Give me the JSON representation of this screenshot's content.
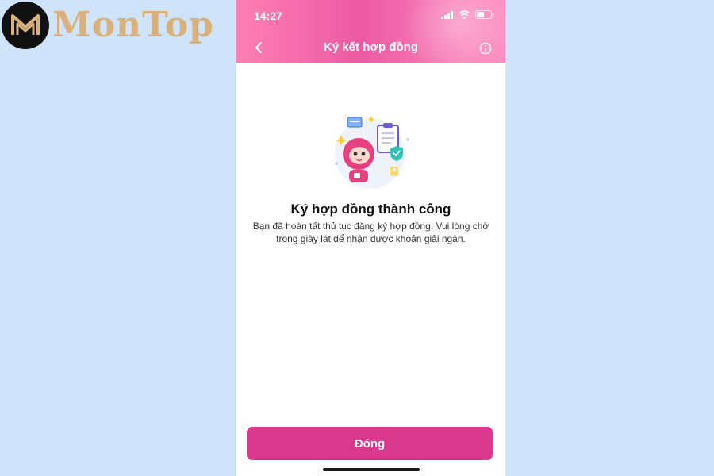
{
  "logo": {
    "text": "MonTop",
    "icon": "montop-logo-icon"
  },
  "status_bar": {
    "time": "14:27"
  },
  "header": {
    "title": "Ký kết hợp đồng",
    "back_icon": "chevron-left-icon",
    "info_icon": "info-icon"
  },
  "content": {
    "title": "Ký hợp đồng thành công",
    "description": "Bạn đã hoàn tất thủ tục đăng ký hợp đồng. Vui lòng chờ trong giây lát để nhận được khoản giải ngân."
  },
  "footer": {
    "close_label": "Đóng"
  },
  "colors": {
    "background": "#cfe3fb",
    "header_pink": "#ec5aa3",
    "button_pink": "#d9388d",
    "logo_gold": "#d8b27a"
  }
}
